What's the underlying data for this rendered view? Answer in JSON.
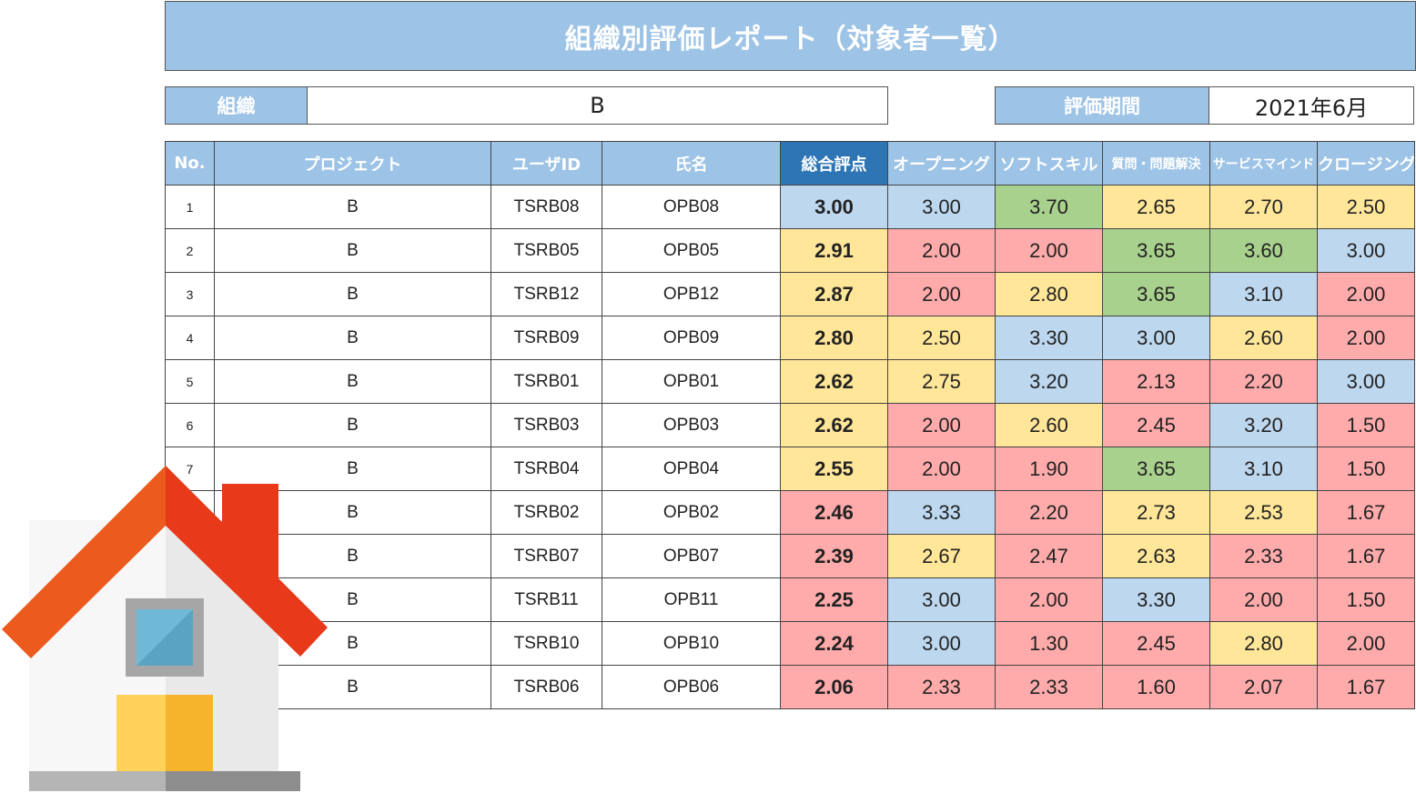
{
  "title": "組織別評価レポート（対象者一覧）",
  "org": {
    "label": "組織",
    "value": "B"
  },
  "period": {
    "label": "評価期間",
    "value": "2021年6月"
  },
  "columns": [
    "No.",
    "プロジェクト",
    "ユーザID",
    "氏名",
    "総合評点",
    "オープニング",
    "ソフトスキル",
    "質問・問題解決",
    "サービスマインド",
    "クロージング"
  ],
  "rows": [
    {
      "no": "1",
      "project": "B",
      "user_id": "TSRB08",
      "name": "OPB08",
      "scores": [
        "3.00",
        "3.00",
        "3.70",
        "2.65",
        "2.70",
        "2.50"
      ],
      "colors": [
        "blue",
        "blue",
        "green",
        "yellow",
        "yellow",
        "yellow"
      ]
    },
    {
      "no": "2",
      "project": "B",
      "user_id": "TSRB05",
      "name": "OPB05",
      "scores": [
        "2.91",
        "2.00",
        "2.00",
        "3.65",
        "3.60",
        "3.00"
      ],
      "colors": [
        "yellow",
        "red",
        "red",
        "green",
        "green",
        "blue"
      ]
    },
    {
      "no": "3",
      "project": "B",
      "user_id": "TSRB12",
      "name": "OPB12",
      "scores": [
        "2.87",
        "2.00",
        "2.80",
        "3.65",
        "3.10",
        "2.00"
      ],
      "colors": [
        "yellow",
        "red",
        "yellow",
        "green",
        "blue",
        "red"
      ]
    },
    {
      "no": "4",
      "project": "B",
      "user_id": "TSRB09",
      "name": "OPB09",
      "scores": [
        "2.80",
        "2.50",
        "3.30",
        "3.00",
        "2.60",
        "2.00"
      ],
      "colors": [
        "yellow",
        "yellow",
        "blue",
        "blue",
        "yellow",
        "red"
      ]
    },
    {
      "no": "5",
      "project": "B",
      "user_id": "TSRB01",
      "name": "OPB01",
      "scores": [
        "2.62",
        "2.75",
        "3.20",
        "2.13",
        "2.20",
        "3.00"
      ],
      "colors": [
        "yellow",
        "yellow",
        "blue",
        "red",
        "red",
        "blue"
      ]
    },
    {
      "no": "6",
      "project": "B",
      "user_id": "TSRB03",
      "name": "OPB03",
      "scores": [
        "2.62",
        "2.00",
        "2.60",
        "2.45",
        "3.20",
        "1.50"
      ],
      "colors": [
        "yellow",
        "red",
        "yellow",
        "red",
        "blue",
        "red"
      ]
    },
    {
      "no": "7",
      "project": "B",
      "user_id": "TSRB04",
      "name": "OPB04",
      "scores": [
        "2.55",
        "2.00",
        "1.90",
        "3.65",
        "3.10",
        "1.50"
      ],
      "colors": [
        "yellow",
        "red",
        "red",
        "green",
        "blue",
        "red"
      ]
    },
    {
      "no": "",
      "project": "B",
      "user_id": "TSRB02",
      "name": "OPB02",
      "scores": [
        "2.46",
        "3.33",
        "2.20",
        "2.73",
        "2.53",
        "1.67"
      ],
      "colors": [
        "red",
        "blue",
        "red",
        "yellow",
        "yellow",
        "red"
      ]
    },
    {
      "no": "",
      "project": "B",
      "user_id": "TSRB07",
      "name": "OPB07",
      "scores": [
        "2.39",
        "2.67",
        "2.47",
        "2.63",
        "2.33",
        "1.67"
      ],
      "colors": [
        "red",
        "yellow",
        "red",
        "yellow",
        "red",
        "red"
      ]
    },
    {
      "no": "",
      "project": "B",
      "user_id": "TSRB11",
      "name": "OPB11",
      "scores": [
        "2.25",
        "3.00",
        "2.00",
        "3.30",
        "2.00",
        "1.50"
      ],
      "colors": [
        "red",
        "blue",
        "red",
        "blue",
        "red",
        "red"
      ]
    },
    {
      "no": "",
      "project": "B",
      "user_id": "TSRB10",
      "name": "OPB10",
      "scores": [
        "2.24",
        "3.00",
        "1.30",
        "2.45",
        "2.80",
        "2.00"
      ],
      "colors": [
        "red",
        "blue",
        "red",
        "red",
        "yellow",
        "red"
      ]
    },
    {
      "no": "",
      "project": "B",
      "user_id": "TSRB06",
      "name": "OPB06",
      "scores": [
        "2.06",
        "2.33",
        "2.33",
        "1.60",
        "2.07",
        "1.67"
      ],
      "colors": [
        "red",
        "red",
        "red",
        "red",
        "red",
        "red"
      ]
    }
  ],
  "colors": {
    "header": "#9dc3e6",
    "header_dark": "#2e75b6",
    "blue": "#bdd7ee",
    "green": "#a9d18e",
    "yellow": "#ffe699",
    "red": "#ffabab"
  },
  "overlay_icon": "home-icon"
}
